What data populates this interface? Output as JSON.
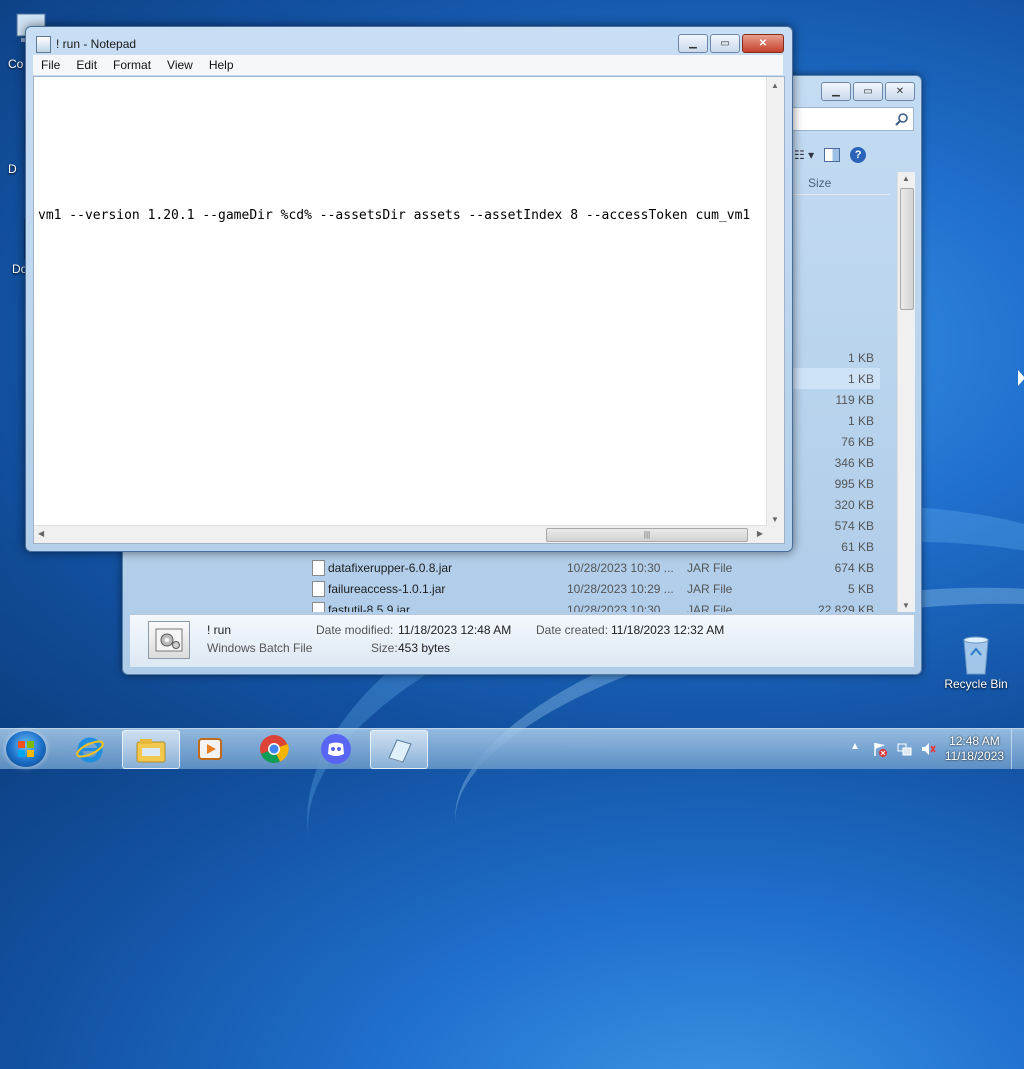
{
  "desktop": {
    "icons": [
      {
        "label": "Co"
      },
      {
        "label": "D"
      },
      {
        "label": "Do"
      }
    ],
    "recycle_bin": "Recycle Bin"
  },
  "explorer": {
    "size_header": "Size",
    "rows": [
      {
        "name": "",
        "date": "",
        "type": "",
        "size": "1 KB",
        "selected": false
      },
      {
        "name": "",
        "date": "",
        "type": "",
        "size": "1 KB",
        "selected": true
      },
      {
        "name": "",
        "date": "",
        "type": "",
        "size": "119 KB",
        "selected": false
      },
      {
        "name": "",
        "date": "",
        "type": "",
        "size": "1 KB",
        "selected": false
      },
      {
        "name": "",
        "date": "",
        "type": "",
        "size": "76 KB",
        "selected": false
      },
      {
        "name": "",
        "date": "",
        "type": "",
        "size": "346 KB",
        "selected": false
      },
      {
        "name": "",
        "date": "",
        "type": "",
        "size": "995 KB",
        "selected": false
      },
      {
        "name": "",
        "date": "",
        "type": "",
        "size": "320 KB",
        "selected": false
      },
      {
        "name": "",
        "date": "",
        "type": "",
        "size": "574 KB",
        "selected": false
      },
      {
        "name": "",
        "date": "",
        "type": "",
        "size": "61 KB",
        "selected": false
      },
      {
        "name": "datafixerupper-6.0.8.jar",
        "date": "10/28/2023 10:30 ...",
        "type": "JAR File",
        "size": "674 KB",
        "selected": false
      },
      {
        "name": "failureaccess-1.0.1.jar",
        "date": "10/28/2023 10:29 ...",
        "type": "JAR File",
        "size": "5 KB",
        "selected": false
      },
      {
        "name": "fastutil-8.5.9.jar",
        "date": "10/28/2023 10:30 ...",
        "type": "JAR File",
        "size": "22,829 KB",
        "selected": false
      }
    ],
    "details": {
      "name": "! run",
      "type": "Windows Batch File",
      "modified_label": "Date modified:",
      "modified_value": "11/18/2023 12:48 AM",
      "created_label": "Date created:",
      "created_value": "11/18/2023 12:32 AM",
      "size_label": "Size:",
      "size_value": "453 bytes"
    }
  },
  "notepad": {
    "title": "! run - Notepad",
    "menu": [
      "File",
      "Edit",
      "Format",
      "View",
      "Help"
    ],
    "content": "vm1 --version 1.20.1 --gameDir %cd% --assetsDir assets --assetIndex 8 --accessToken cum_vm1"
  },
  "taskbar": {
    "apps": [
      "explorer-icon",
      "ie-icon",
      "file-explorer-icon",
      "media-player-icon",
      "chrome-icon",
      "discord-icon",
      "notepad-icon"
    ],
    "time": "12:48 AM",
    "date": "11/18/2023"
  }
}
